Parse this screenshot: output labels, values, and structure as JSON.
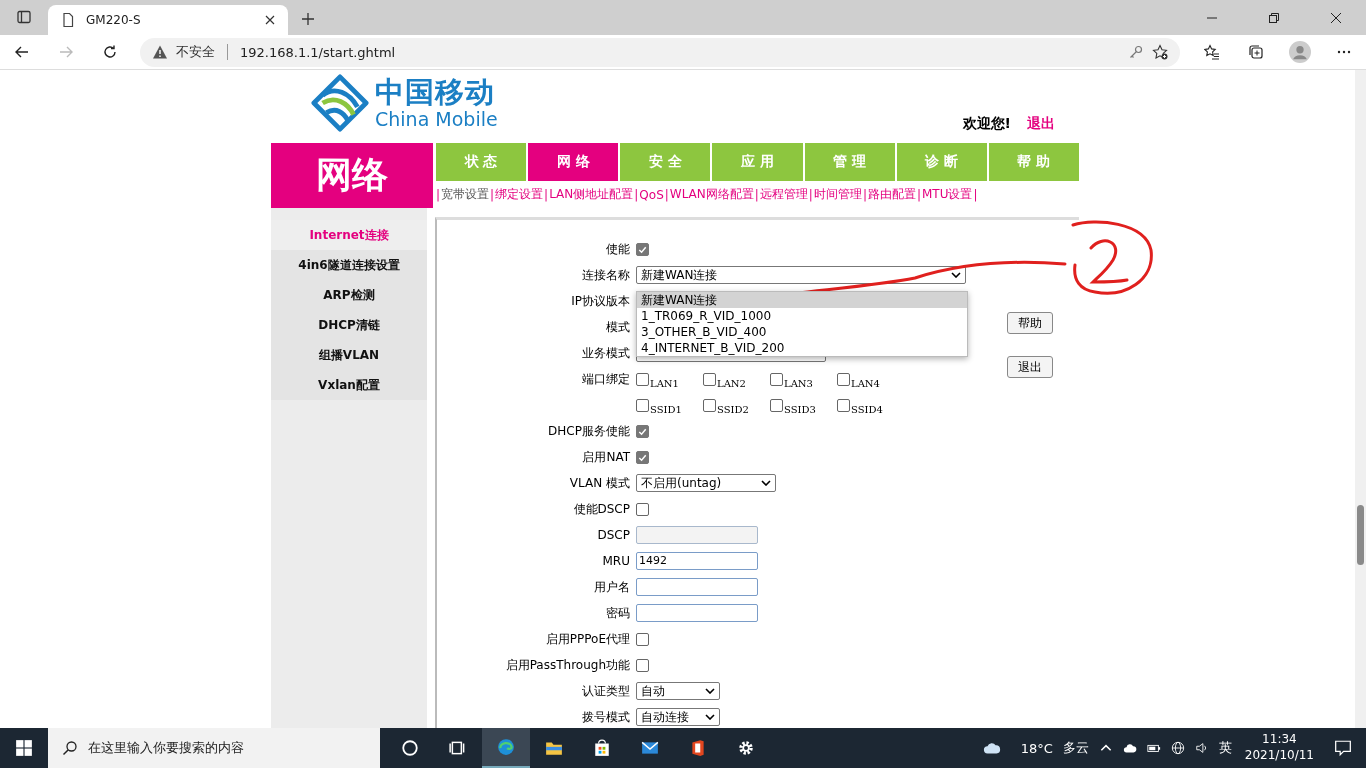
{
  "browser": {
    "tab_title": "GM220-S",
    "security": "不安全",
    "url": "192.168.1.1/start.ghtml"
  },
  "header": {
    "logo_cn": "中国移动",
    "logo_en": "China Mobile",
    "welcome": "欢迎您!",
    "logout": "退出"
  },
  "section_title": "网络",
  "nav_tabs": [
    {
      "label": "状 态",
      "selected": false
    },
    {
      "label": "网 络",
      "selected": true
    },
    {
      "label": "安 全",
      "selected": false
    },
    {
      "label": "应 用",
      "selected": false
    },
    {
      "label": "管 理",
      "selected": false
    },
    {
      "label": "诊 断",
      "selected": false
    },
    {
      "label": "帮 助",
      "selected": false
    }
  ],
  "sub_menu": {
    "separator": "|",
    "items": [
      {
        "label": "宽带设置",
        "selected": true
      },
      {
        "label": "绑定设置",
        "selected": false
      },
      {
        "label": "LAN侧地址配置",
        "selected": false
      },
      {
        "label": "QoS",
        "selected": false
      },
      {
        "label": "WLAN网络配置",
        "selected": false
      },
      {
        "label": "远程管理",
        "selected": false
      },
      {
        "label": "时间管理",
        "selected": false
      },
      {
        "label": "路由配置",
        "selected": false
      },
      {
        "label": "MTU设置",
        "selected": false
      }
    ]
  },
  "sidebar": {
    "items": [
      {
        "label": "Internet连接",
        "selected": true
      },
      {
        "label": "4in6隧道连接设置",
        "selected": false
      },
      {
        "label": "ARP检测",
        "selected": false
      },
      {
        "label": "DHCP清链",
        "selected": false
      },
      {
        "label": "组播VLAN",
        "selected": false
      },
      {
        "label": "Vxlan配置",
        "selected": false
      }
    ]
  },
  "form": [
    {
      "kind": "checkbox",
      "label": "使能",
      "checked": true
    },
    {
      "kind": "select",
      "label": "连接名称",
      "value": "新建WAN连接"
    },
    {
      "kind": "covered",
      "label": "IP协议版本"
    },
    {
      "kind": "covered",
      "label": "模式"
    },
    {
      "kind": "select",
      "label": "业务模式"
    },
    {
      "kind": "checks",
      "label": "端口绑定",
      "items": [
        {
          "label": "LAN1",
          "checked": false
        },
        {
          "label": "LAN2",
          "checked": false
        },
        {
          "label": "LAN3",
          "checked": false
        },
        {
          "label": "LAN4",
          "checked": false
        }
      ]
    },
    {
      "kind": "checks",
      "items": [
        {
          "label": "SSID1",
          "checked": false
        },
        {
          "label": "SSID2",
          "checked": false
        },
        {
          "label": "SSID3",
          "checked": false
        },
        {
          "label": "SSID4",
          "checked": false
        }
      ]
    },
    {
      "kind": "checkbox",
      "label": "DHCP服务使能",
      "checked": true
    },
    {
      "kind": "checkbox",
      "label": "启用NAT",
      "checked": true
    },
    {
      "kind": "select",
      "label": "VLAN 模式",
      "value": "不启用(untag)"
    },
    {
      "kind": "checkbox",
      "label": "使能DSCP",
      "checked": false
    },
    {
      "kind": "input",
      "label": "DSCP",
      "disabled": true
    },
    {
      "kind": "input",
      "label": "MRU",
      "value": "1492",
      "disabled": false
    },
    {
      "kind": "input",
      "label": "用户名",
      "disabled": false
    },
    {
      "kind": "input",
      "label": "密码",
      "disabled": false
    },
    {
      "kind": "checkbox",
      "label": "启用PPPoE代理",
      "checked": false
    },
    {
      "kind": "checkbox",
      "label": "启用PassThrough功能",
      "checked": false
    },
    {
      "kind": "select",
      "label": "认证类型",
      "value": "自动"
    },
    {
      "kind": "select",
      "label": "拨号模式",
      "value": "自动连接"
    }
  ],
  "dropdown": {
    "options": [
      {
        "label": "新建WAN连接",
        "selected": true
      },
      {
        "label": "1_TR069_R_VID_1000",
        "selected": false
      },
      {
        "label": "3_OTHER_B_VID_400",
        "selected": false
      },
      {
        "label": "4_INTERNET_B_VID_200",
        "selected": false
      }
    ]
  },
  "side_buttons": [
    "帮助",
    "退出"
  ],
  "taskbar": {
    "search_placeholder": "在这里输入你要搜索的内容",
    "temperature": "18°C",
    "weather": "多云",
    "ime": "英",
    "time": "11:34",
    "date": "2021/10/11"
  }
}
